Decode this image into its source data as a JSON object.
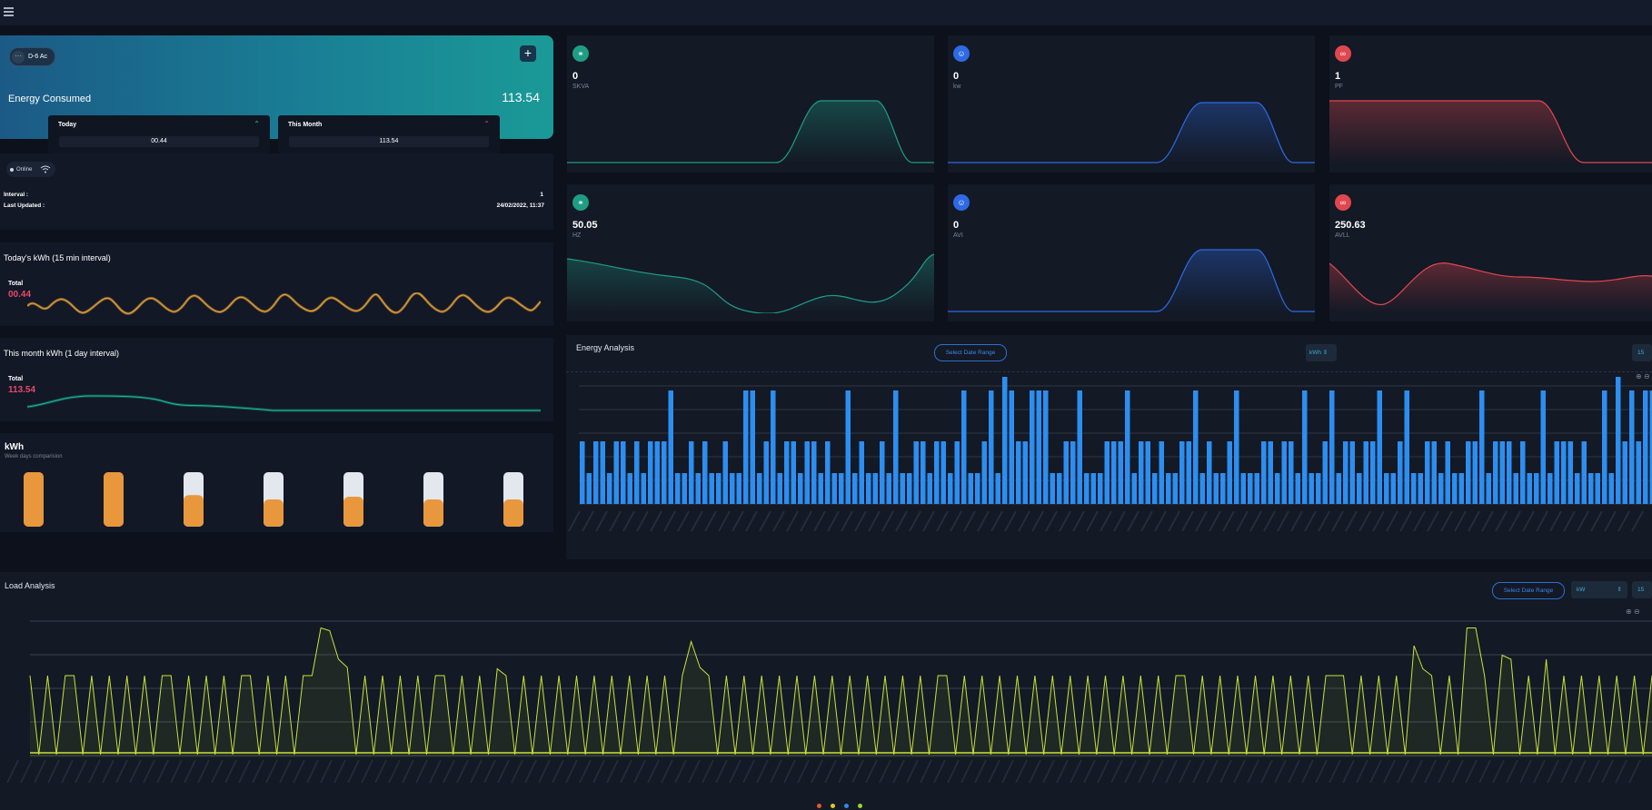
{
  "nav": {
    "menu_icon": "hamburger-menu-icon"
  },
  "energy_card": {
    "device": "D-6 Ac",
    "add_icon": "+",
    "title": "Energy Consumed",
    "value": "113.54",
    "today": {
      "label": "Today",
      "value": "00.44"
    },
    "month": {
      "label": "This Month",
      "value": "113.54"
    }
  },
  "status": {
    "online": "Online",
    "interval_label": "Interval :",
    "interval_value": "1",
    "updated_label": "Last Updated :",
    "updated_value": "24/02/2022, 11:37"
  },
  "today_chart": {
    "title": "Today's kWh (15 min interval)",
    "total_label": "Total",
    "total_value": "00.44"
  },
  "month_chart": {
    "title": "This month kWh (1 day interval)",
    "total_label": "Total",
    "total_value": "113.54"
  },
  "weekday_chart": {
    "title": "kWh",
    "subtitle": "Week days comparision",
    "fills": [
      1,
      1,
      0.58,
      0.5,
      0.55,
      0.5,
      0.5
    ]
  },
  "stats": [
    {
      "value": "0",
      "label": "SKVA",
      "icon": "chat-icon",
      "color": "#1f9d84"
    },
    {
      "value": "0",
      "label": "kw",
      "icon": "users-icon",
      "color": "#2d6ae3"
    },
    {
      "value": "1",
      "label": "PF",
      "icon": "link-icon",
      "color": "#e0474f"
    },
    {
      "value": "50.05",
      "label": "HZ",
      "icon": "chat-icon",
      "color": "#1f9d84"
    },
    {
      "value": "0",
      "label": "AVI",
      "icon": "users-icon",
      "color": "#2d6ae3"
    },
    {
      "value": "250.63",
      "label": "AVLL",
      "icon": "link-icon",
      "color": "#e0474f"
    }
  ],
  "energy_analysis": {
    "title": "Energy Analysis",
    "date_button": "Select Date Range",
    "unit_select": "kWh",
    "interval_select": "15"
  },
  "load_analysis": {
    "title": "Load Analysis",
    "date_button": "Select Date Range",
    "unit_select": "kW",
    "interval_select": "15"
  },
  "chart_data": [
    {
      "type": "bar",
      "title": "Energy Analysis",
      "series": [
        {
          "values": [
            3,
            2,
            3,
            3,
            2,
            3,
            3,
            2,
            3,
            2,
            3,
            3,
            3,
            5,
            2,
            2,
            3,
            2,
            3,
            2,
            2,
            3,
            2,
            2,
            5,
            5,
            2,
            3,
            5,
            2,
            3,
            3,
            2,
            3,
            3,
            2,
            3,
            2,
            2,
            5,
            2,
            3,
            2,
            2,
            3,
            2,
            5,
            2,
            2,
            3,
            3,
            2,
            3,
            3,
            2,
            3,
            5,
            2,
            2,
            3,
            5,
            2,
            6,
            5,
            3,
            3,
            5,
            5,
            5,
            2,
            2,
            3,
            3,
            5,
            2,
            2,
            2,
            3,
            3,
            3,
            5,
            2,
            3,
            3,
            2,
            3,
            2,
            2,
            3,
            3,
            5,
            2,
            3,
            2,
            2,
            3,
            5,
            2,
            2,
            2,
            3,
            3,
            2,
            3,
            3,
            2,
            5,
            2,
            2,
            3,
            5,
            2,
            3,
            3,
            2,
            3,
            3,
            5,
            2,
            2,
            3,
            5,
            2,
            2,
            3,
            3,
            2,
            3,
            2,
            2,
            3,
            3,
            5,
            2,
            3,
            3,
            3,
            2,
            3,
            2,
            2,
            5,
            2,
            3,
            3,
            3,
            2,
            3,
            2,
            2,
            5,
            2,
            6,
            3,
            5,
            3,
            5,
            5
          ]
        }
      ]
    },
    {
      "type": "line",
      "title": "Load Analysis",
      "series": [
        {
          "values": [
            0.6,
            0.02,
            0.6,
            0.02,
            0.6,
            0.6,
            0.02,
            0.6,
            0.02,
            0.6,
            0.02,
            0.6,
            0.02,
            0.6,
            0.02,
            0.6,
            0.6,
            0.02,
            0.6,
            0.02,
            0.6,
            0.02,
            0.6,
            0.02,
            0.6,
            0.6,
            0.02,
            0.6,
            0.02,
            0.6,
            0.02,
            0.6,
            0.6,
            0.02,
            0.6,
            0.02,
            0.6,
            0.02,
            0.6,
            0.02,
            0.6,
            0.02,
            0.6,
            0.02,
            0.6,
            0.02,
            0.6,
            0.6,
            0.02,
            0.6,
            0.02,
            0.6,
            0.02,
            0.65,
            0.6,
            0.02,
            0.6,
            0.02,
            0.6,
            0.02,
            0.6,
            0.02,
            0.6,
            0.02,
            0.6,
            0.02,
            0.6,
            0.02,
            0.6,
            0.02,
            0.6,
            0.02,
            0.6,
            0.02,
            0.6,
            0.6,
            0.02,
            0.6,
            0.02,
            0.6,
            0.02,
            0.6,
            0.02,
            0.6,
            0.02,
            0.6,
            0.02,
            0.6,
            0.02,
            0.6,
            0.02,
            0.6,
            0.02,
            0.6,
            0.02,
            0.6,
            0.02,
            0.6,
            0.02,
            0.6,
            0.02,
            0.6,
            0.02,
            0.6,
            0.6,
            0.02,
            0.6,
            0.02,
            0.6,
            0.02,
            0.6,
            0.02,
            0.6,
            0.02,
            0.6,
            0.02,
            0.6,
            0.02,
            0.6,
            0.02,
            0.6,
            0.02,
            0.6,
            0.02,
            0.6,
            0.02,
            0.6,
            0.02,
            0.6,
            0.02,
            0.6,
            0.6,
            0.02,
            0.6,
            0.02,
            0.6,
            0.02,
            0.6,
            0.02,
            0.6,
            0.02,
            0.6,
            0.02,
            0.6,
            0.02,
            0.6,
            0.02,
            0.6,
            0.6,
            0.6,
            0.02,
            0.6,
            0.02,
            0.6,
            0.02,
            0.6,
            0.02,
            0.6,
            0.02,
            0.6,
            0.02,
            0.6,
            0.02,
            0.6,
            0.02,
            0.6,
            0.02,
            0.6,
            0.6,
            0.02,
            0.6,
            0.02,
            0.6,
            0.02,
            0.6,
            0.02,
            0.6,
            0.02,
            0.6,
            0.02,
            0.6,
            0.02,
            0.6,
            0.02,
            0.6
          ]
        }
      ]
    }
  ]
}
